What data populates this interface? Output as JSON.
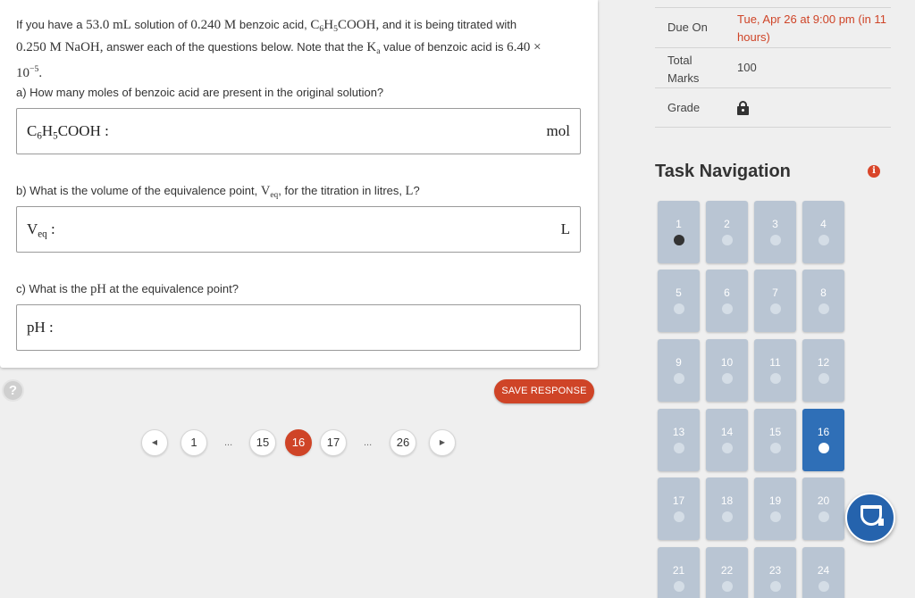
{
  "question": {
    "intro": {
      "t1": "If you have a ",
      "m1": "53.0 mL",
      "t2": " solution of ",
      "m2": "0.240 M",
      "t3": " benzoic acid, ",
      "m3a": "C",
      "m3b": "6",
      "m3c": "H",
      "m3d": "5",
      "m3e": "COOH,",
      "t4": " and it is being titrated with",
      "m4": "0.250 M NaOH,",
      "t5": " answer each of the questions below. Note that the ",
      "m5a": "K",
      "m5b": "a",
      "t6": " value of benzoic acid is ",
      "m6": "6.40 ×",
      "m7a": "10",
      "m7b": "−5",
      "m7c": "."
    },
    "part_a": {
      "label": "a) How many moles of benzoic acid are present in the original solution?",
      "field_a": "C",
      "field_b": "6",
      "field_c": "H",
      "field_d": "5",
      "field_e": "COOH :",
      "unit": "mol",
      "value": ""
    },
    "part_b": {
      "t1": "b) What is the volume of the equivalence point, ",
      "m1a": "V",
      "m1b": "eq",
      "t2": ", for the titration in litres, ",
      "m2": "L",
      "t3": "?",
      "field_a": "V",
      "field_b": "eq",
      "field_c": " :",
      "unit": "L",
      "value": ""
    },
    "part_c": {
      "t1": "c) What is the ",
      "m1": "pH",
      "t2": " at the equivalence point?",
      "field": "pH :",
      "value": ""
    }
  },
  "actions": {
    "help": "?",
    "save": "SAVE RESPONSE"
  },
  "pagination": {
    "prev": "◀",
    "next": "▶",
    "first": "1",
    "ellipsis": "...",
    "p15": "15",
    "p16": "16",
    "p17": "17",
    "last": "26",
    "current": "16"
  },
  "info": {
    "due_label": "Due On",
    "due_value": "Tue, Apr 26 at 9:00 pm (in 11 hours)",
    "marks_label": "Total Marks",
    "marks_value": "100",
    "grade_label": "Grade",
    "grade_icon": "lock-icon"
  },
  "task_nav": {
    "title": "Task Navigation",
    "info_icon": "i",
    "tiles": [
      {
        "n": "1",
        "state": "visited"
      },
      {
        "n": "2",
        "state": ""
      },
      {
        "n": "3",
        "state": ""
      },
      {
        "n": "4",
        "state": ""
      },
      {
        "n": "5",
        "state": ""
      },
      {
        "n": "6",
        "state": ""
      },
      {
        "n": "7",
        "state": ""
      },
      {
        "n": "8",
        "state": ""
      },
      {
        "n": "9",
        "state": ""
      },
      {
        "n": "10",
        "state": ""
      },
      {
        "n": "11",
        "state": ""
      },
      {
        "n": "12",
        "state": ""
      },
      {
        "n": "13",
        "state": ""
      },
      {
        "n": "14",
        "state": ""
      },
      {
        "n": "15",
        "state": ""
      },
      {
        "n": "16",
        "state": "current"
      },
      {
        "n": "17",
        "state": ""
      },
      {
        "n": "18",
        "state": ""
      },
      {
        "n": "19",
        "state": ""
      },
      {
        "n": "20",
        "state": ""
      },
      {
        "n": "21",
        "state": ""
      },
      {
        "n": "22",
        "state": ""
      },
      {
        "n": "23",
        "state": ""
      },
      {
        "n": "24",
        "state": ""
      }
    ]
  },
  "colors": {
    "accent": "#cf4427",
    "tile": "#b9c5d3",
    "tile_current": "#2f6fb7",
    "chat": "#2563ad"
  },
  "chat": {
    "icon": "chat-icon"
  }
}
